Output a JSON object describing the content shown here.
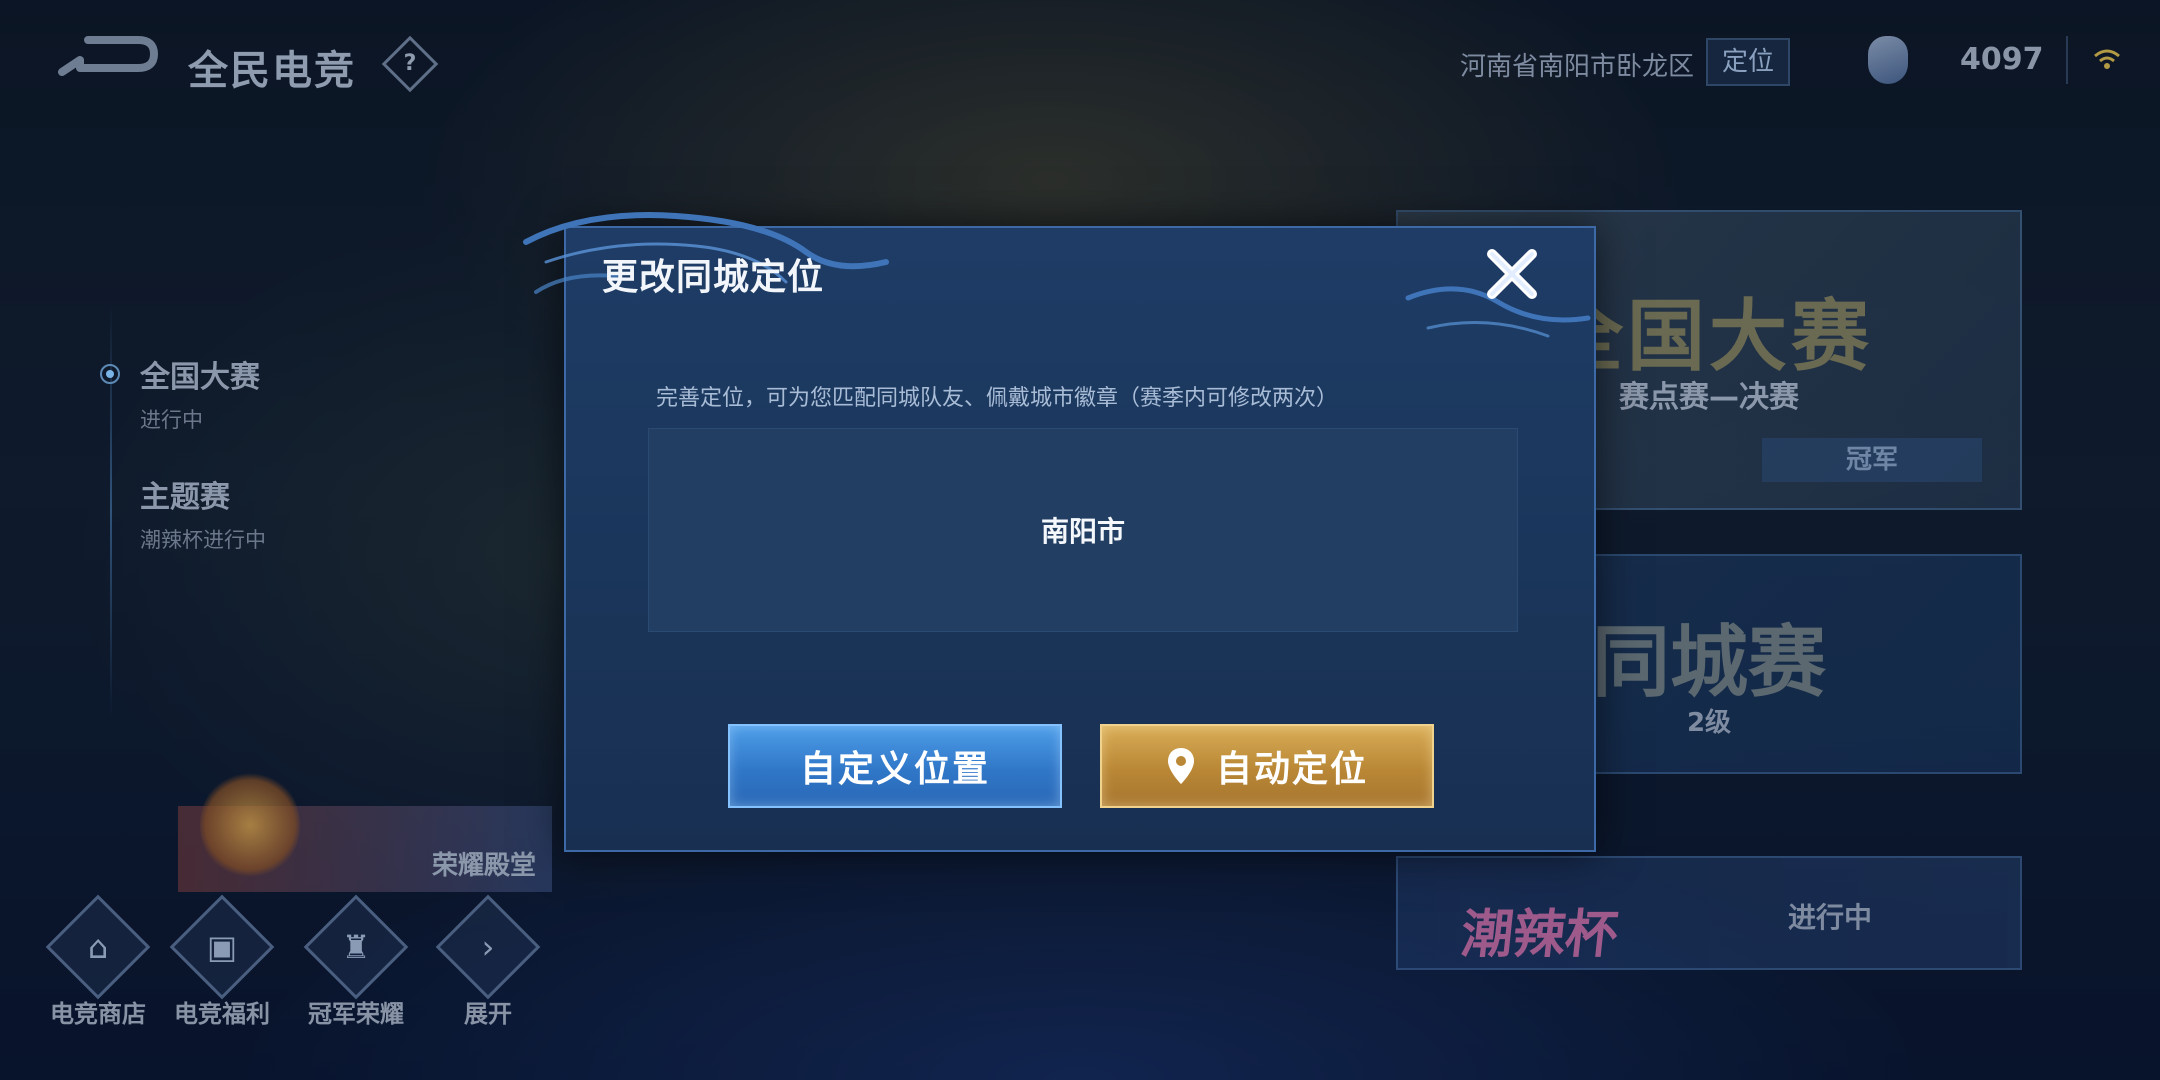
{
  "header": {
    "app_title": "全民电竞",
    "help_icon": "?",
    "region": "河南省南阳市卧龙区",
    "locate_button": "定位",
    "coins": "4097"
  },
  "left_nav": {
    "items": [
      {
        "title": "全国大赛",
        "subtitle": "进行中"
      },
      {
        "title": "主题赛",
        "subtitle": "潮辣杯进行中"
      }
    ],
    "honor_hall": "荣耀殿堂"
  },
  "bottom_nav": [
    {
      "label": "电竞商店",
      "icon": "shop-icon"
    },
    {
      "label": "电竞福利",
      "icon": "gift-icon"
    },
    {
      "label": "冠军荣耀",
      "icon": "trophy-icon"
    },
    {
      "label": "展开",
      "icon": "expand-arrow-icon"
    }
  ],
  "cards": {
    "national": {
      "title": "全国大赛",
      "stage": "赛点赛—决赛",
      "badge": "冠军"
    },
    "city": {
      "title": "同城赛",
      "level": "2级"
    },
    "cup": {
      "logo": "潮辣杯",
      "status": "进行中"
    }
  },
  "modal": {
    "title": "更改同城定位",
    "description": "完善定位，可为您匹配同城队友、佩戴城市徽章（赛季内可修改两次）",
    "city": "南阳市",
    "custom_button": "自定义位置",
    "auto_button": "自动定位"
  },
  "colors": {
    "modal_bg": "#1e3c66",
    "custom_button": "#3a86d6",
    "auto_button": "#c99a45"
  }
}
